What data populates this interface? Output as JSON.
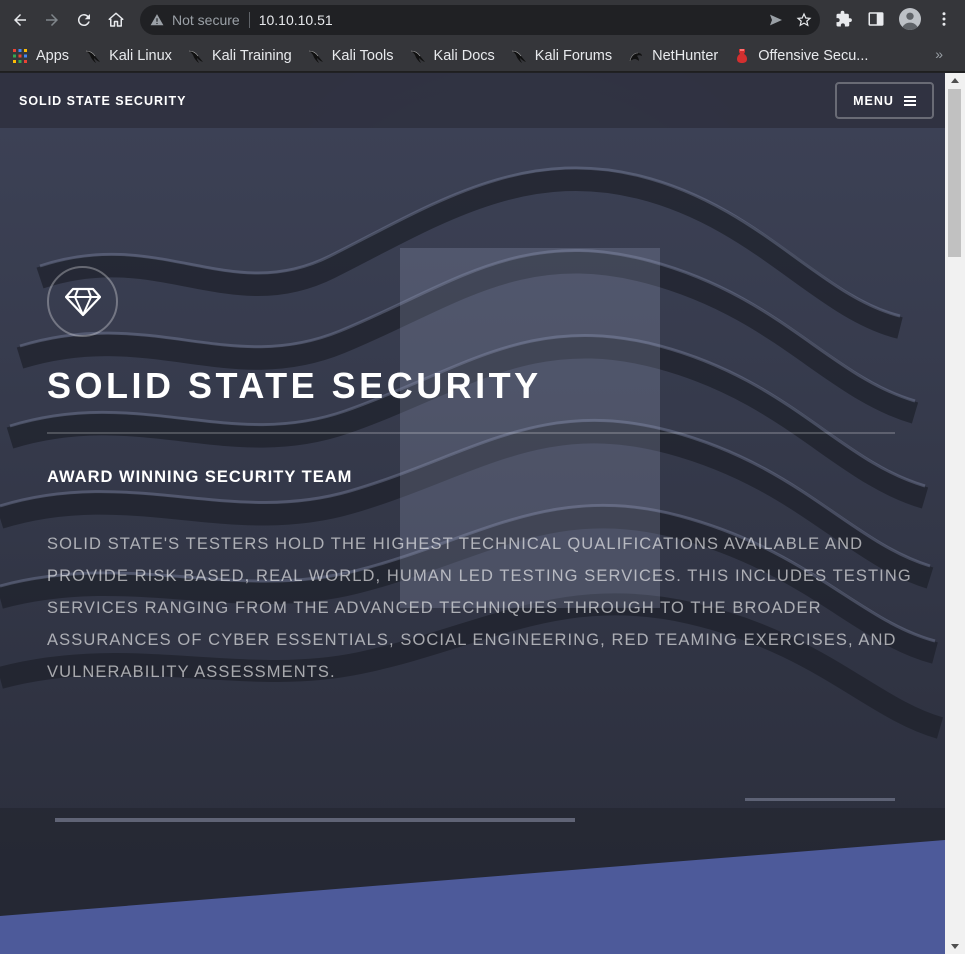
{
  "browser": {
    "not_secure": "Not secure",
    "url": "10.10.10.51",
    "bookmarks": [
      {
        "label": "Apps",
        "icon": "apps-grid-icon"
      },
      {
        "label": "Kali Linux",
        "icon": "kali-dragon-icon"
      },
      {
        "label": "Kali Training",
        "icon": "kali-dragon-icon"
      },
      {
        "label": "Kali Tools",
        "icon": "kali-dragon-icon"
      },
      {
        "label": "Kali Docs",
        "icon": "kali-dragon-icon"
      },
      {
        "label": "Kali Forums",
        "icon": "kali-dragon-icon"
      },
      {
        "label": "NetHunter",
        "icon": "nethunter-icon"
      },
      {
        "label": "Offensive Secu...",
        "icon": "offsec-icon"
      }
    ],
    "more": "»"
  },
  "site": {
    "brand": "SOLID STATE SECURITY",
    "menu_label": "MENU",
    "hero": {
      "icon": "diamond-icon",
      "title": "SOLID STATE SECURITY",
      "subtitle": "AWARD WINNING SECURITY TEAM",
      "body": "SOLID STATE'S TESTERS HOLD THE HIGHEST TECHNICAL QUALIFICATIONS AVAILABLE AND PROVIDE RISK BASED, REAL WORLD, HUMAN LED TESTING SERVICES. THIS INCLUDES TESTING SERVICES RANGING FROM THE ADVANCED TECHNIQUES THROUGH TO THE BROADER ASSURANCES OF CYBER ESSENTIALS, SOCIAL ENGINEERING, RED TEAMING EXERCISES, AND VULNERABILITY ASSESSMENTS."
    },
    "colors": {
      "header": "#2f3140",
      "wave": "#4d5a9a",
      "text": "#ffffff"
    }
  }
}
